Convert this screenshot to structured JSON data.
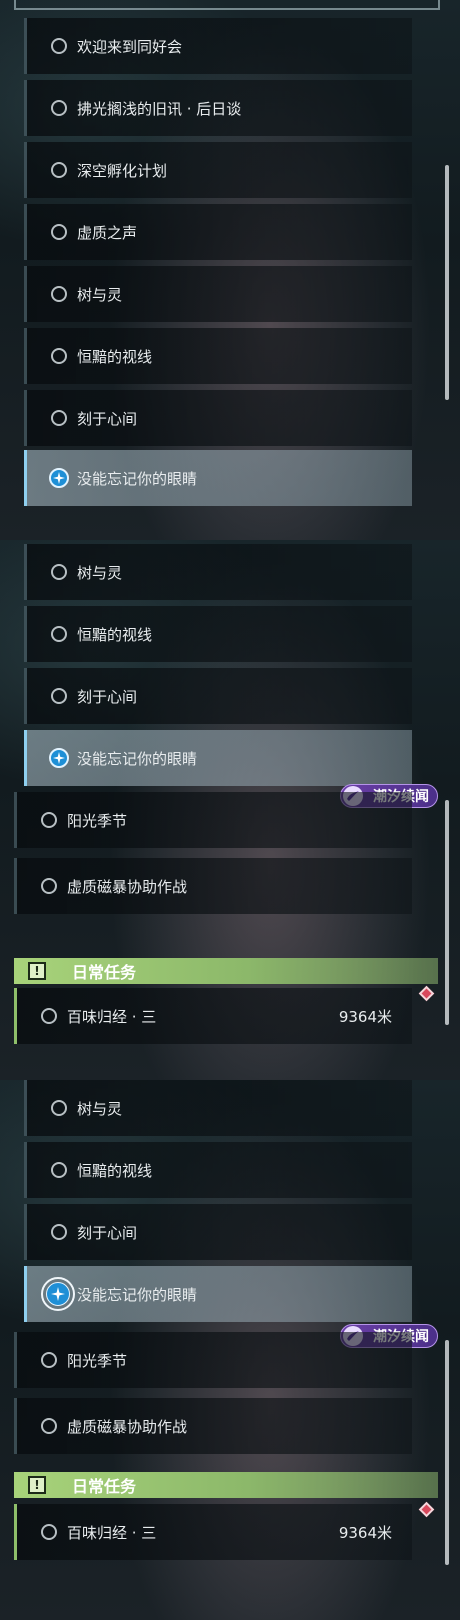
{
  "panel1": {
    "quests": [
      {
        "label": "欢迎来到同好会",
        "active": false
      },
      {
        "label": "拂光搁浅的旧讯 · 后日谈",
        "active": false
      },
      {
        "label": "深空孵化计划",
        "active": false
      },
      {
        "label": "虚质之声",
        "active": false
      },
      {
        "label": "树与灵",
        "active": false
      },
      {
        "label": "恒黯的视线",
        "active": false
      },
      {
        "label": "刻于心间",
        "active": false
      },
      {
        "label": "没能忘记你的眼睛",
        "active": true
      }
    ]
  },
  "panel2": {
    "quests": [
      {
        "label": "树与灵",
        "active": false
      },
      {
        "label": "恒黯的视线",
        "active": false
      },
      {
        "label": "刻于心间",
        "active": false
      },
      {
        "label": "没能忘记你的眼睛",
        "active": true
      }
    ],
    "badge": "潮汐续闻",
    "tide_quests": [
      {
        "label": "阳光季节"
      },
      {
        "label": "虚质磁暴协助作战"
      }
    ],
    "daily_header": "日常任务",
    "daily_header_icon": "!",
    "daily_quest": {
      "label": "百味归经 · 三",
      "distance": "9364米"
    }
  },
  "panel3": {
    "quests": [
      {
        "label": "树与灵",
        "active": false
      },
      {
        "label": "恒黯的视线",
        "active": false
      },
      {
        "label": "刻于心间",
        "active": false
      },
      {
        "label": "没能忘记你的眼睛",
        "active": true
      }
    ],
    "badge": "潮汐续闻",
    "tide_quests": [
      {
        "label": "阳光季节"
      },
      {
        "label": "虚质磁暴协助作战"
      }
    ],
    "daily_header": "日常任务",
    "daily_header_icon": "!",
    "daily_quest": {
      "label": "百味归经 · 三",
      "distance": "9364米"
    }
  },
  "colors": {
    "active_accent": "#8fd0f0",
    "tracker_blue": "#1e8fd6",
    "tide_purple": "#6b3fa8",
    "daily_green": "#a8d37a",
    "gem_red": "#d8485c"
  },
  "icons": {
    "inactive": "circle-outline-icon",
    "active": "compass-star-icon",
    "badge": "tide-wave-icon",
    "daily": "exclamation-box-icon",
    "marker": "red-diamond-icon"
  }
}
